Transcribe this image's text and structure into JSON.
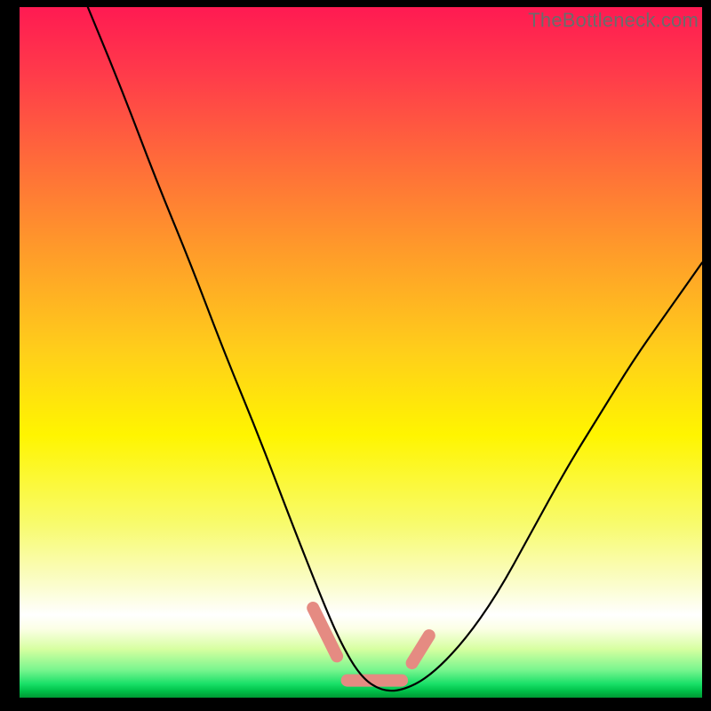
{
  "watermark": {
    "text": "TheBottleneck.com"
  },
  "chart_data": {
    "type": "line",
    "title": "",
    "xlabel": "",
    "ylabel": "",
    "xlim": [
      0,
      100
    ],
    "ylim": [
      0,
      100
    ],
    "grid": false,
    "legend": false,
    "series": [
      {
        "name": "bottleneck-curve",
        "x": [
          10,
          15,
          20,
          25,
          30,
          35,
          40,
          44,
          47,
          50,
          53,
          56,
          60,
          65,
          70,
          75,
          80,
          85,
          90,
          95,
          100
        ],
        "values": [
          100,
          88,
          75,
          63,
          50,
          38,
          25,
          15,
          8,
          3,
          1,
          1,
          3,
          8,
          15,
          24,
          33,
          41,
          49,
          56,
          63
        ]
      }
    ],
    "markers": [
      {
        "name": "pink-segment-1",
        "x": [
          43,
          46.5
        ],
        "y": [
          13,
          6
        ]
      },
      {
        "name": "pink-segment-2",
        "x": [
          48,
          56
        ],
        "y": [
          2.5,
          2.5
        ]
      },
      {
        "name": "pink-segment-3",
        "x": [
          57.5,
          60
        ],
        "y": [
          5,
          9
        ]
      }
    ],
    "background": {
      "type": "vertical-gradient",
      "stops": [
        {
          "pos": 0.0,
          "color": "#ff1a52"
        },
        {
          "pos": 0.5,
          "color": "#ffcf1a"
        },
        {
          "pos": 0.88,
          "color": "#ffffff"
        },
        {
          "pos": 1.0,
          "color": "#009933"
        }
      ]
    }
  }
}
